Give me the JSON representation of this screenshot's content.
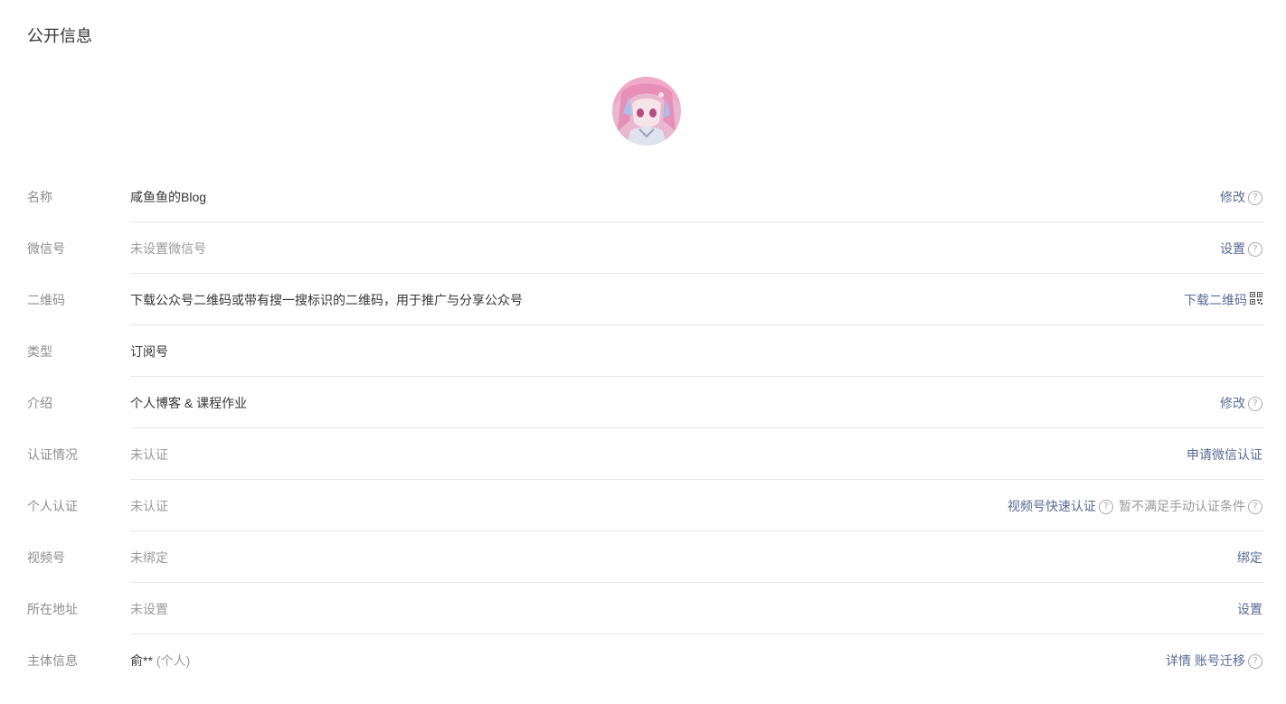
{
  "header": {
    "title": "公开信息"
  },
  "avatar": {
    "icon": "anime-girl-avatar",
    "colors": [
      "#f3b3cf",
      "#d985b3",
      "#b7c6e6"
    ]
  },
  "rows": [
    {
      "label": "名称",
      "value": "咸鱼鱼的Blog",
      "actions": [
        {
          "text": "修改"
        }
      ]
    },
    {
      "label": "微信号",
      "value": "未设置微信号",
      "actions": [
        {
          "text": "设置"
        }
      ]
    },
    {
      "label": "二维码",
      "value": "下载公众号二维码或带有搜一搜标识的二维码，用于推广与分享公众号",
      "actions": [
        {
          "text": "下载二维码"
        }
      ]
    },
    {
      "label": "类型",
      "value": "订阅号"
    },
    {
      "label": "介绍",
      "value": "个人博客 & 课程作业",
      "actions": [
        {
          "text": "修改"
        }
      ]
    },
    {
      "label": "认证情况",
      "value": "未认证",
      "actions": [
        {
          "text": "申请微信认证"
        }
      ]
    },
    {
      "label": "个人认证",
      "value": "未认证",
      "actions": [
        {
          "text": "视频号快速认证"
        },
        {
          "text": "暂不满足手动认证条件"
        }
      ]
    },
    {
      "label": "视频号",
      "value": "未绑定",
      "actions": [
        {
          "text": "绑定"
        }
      ]
    },
    {
      "label": "所在地址",
      "value": "未设置",
      "actions": [
        {
          "text": "设置"
        }
      ]
    },
    {
      "label": "主体信息",
      "value": "俞**",
      "value_sub": "(个人)",
      "actions": [
        {
          "text": "详情"
        },
        {
          "text": "账号迁移"
        }
      ]
    }
  ],
  "help_glyph": "?",
  "colors": {
    "link": "#576b95",
    "muted": "#9a9a9a",
    "divider": "#e7e7eb"
  }
}
